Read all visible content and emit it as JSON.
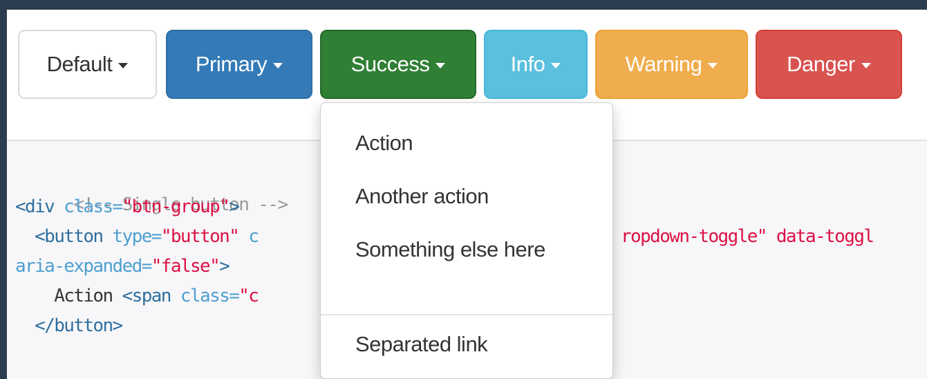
{
  "buttons": [
    {
      "label": "Default",
      "style": "default",
      "color": "#ffffff"
    },
    {
      "label": "Primary",
      "style": "primary",
      "color": "#337ab7"
    },
    {
      "label": "Success",
      "style": "success",
      "color": "#2f7f35"
    },
    {
      "label": "Info",
      "style": "info",
      "color": "#5bc0de"
    },
    {
      "label": "Warning",
      "style": "warning",
      "color": "#f0ad4e"
    },
    {
      "label": "Danger",
      "style": "danger",
      "color": "#d9534f"
    }
  ],
  "dropdown": {
    "items": [
      "Action",
      "Another action",
      "Something else here"
    ],
    "separated_item": "Separated link"
  },
  "code": {
    "comment": "<!-- Single button -->",
    "line2_open": "<div ",
    "line2_attr": "class=",
    "line2_val": "\"btn-group\"",
    "line2_close": ">",
    "line3_open": "  <button ",
    "line3_attr": "type=",
    "line3_val": "\"button\"",
    "line3_rest": " c",
    "line3_right": "ropdown-toggle\" data-toggl",
    "line4_attr": "aria-expanded=",
    "line4_val": "\"false\"",
    "line4_close": ">",
    "line5_text": "    Action ",
    "line5_tag": "<span ",
    "line5_attr": "class=",
    "line5_val": "\"c",
    "line6_tag": "  </button>"
  }
}
